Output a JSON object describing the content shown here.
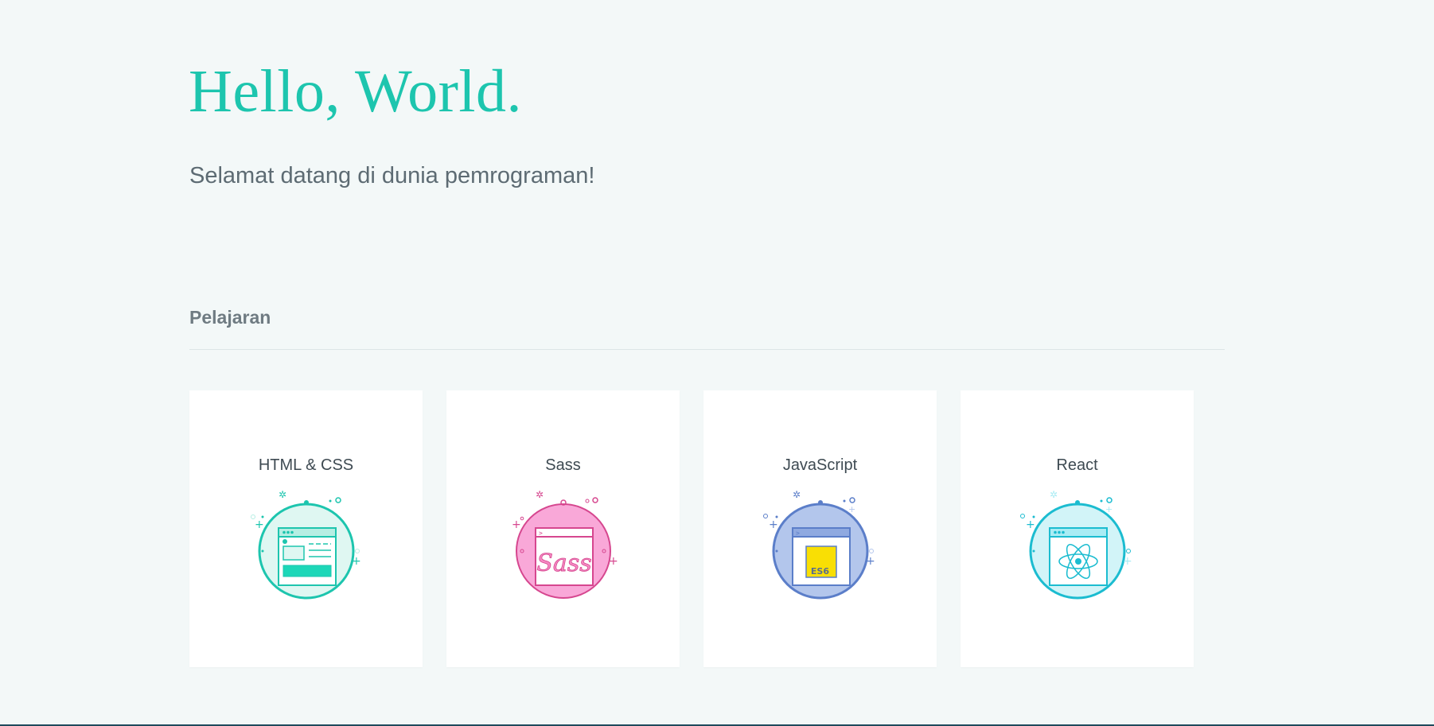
{
  "hero": {
    "title": "Hello, World.",
    "subtitle": "Selamat datang di dunia pemrograman!"
  },
  "lessons": {
    "section_title": "Pelajaran",
    "cards": [
      {
        "title": "HTML & CSS",
        "icon": "html-css-icon",
        "color": "#1dc5ae"
      },
      {
        "title": "Sass",
        "icon": "sass-icon",
        "color": "#d6478f"
      },
      {
        "title": "JavaScript",
        "icon": "javascript-icon",
        "color": "#5b7ec9"
      },
      {
        "title": "React",
        "icon": "react-icon",
        "color": "#1bbcd0"
      }
    ],
    "es6_label": "ES6",
    "sass_logo_text": "Sass"
  },
  "colors": {
    "accent": "#1dc5ae",
    "background": "#f3f8f8"
  }
}
